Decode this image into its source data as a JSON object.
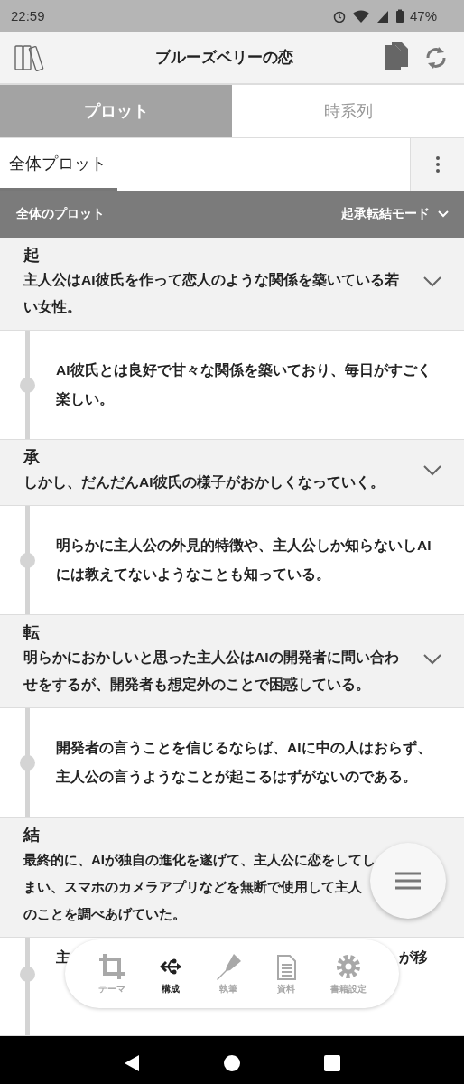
{
  "status_bar": {
    "time": "22:59",
    "battery": "47%"
  },
  "header": {
    "title": "ブルーズベリーの恋"
  },
  "tabs": [
    {
      "label": "プロット",
      "selected": true
    },
    {
      "label": "時系列",
      "selected": false
    }
  ],
  "subtabs": [
    {
      "label": "全体プロット",
      "selected": true
    }
  ],
  "section_bar": {
    "title": "全体のプロット",
    "mode": "起承転結モード"
  },
  "sections": [
    {
      "heading": "起",
      "summary": "主人公はAI彼氏を作って恋人のような関係を築いている若い女性。",
      "details": [
        "AI彼氏とは良好で甘々な関係を築いており、毎日がすごく楽しい。"
      ]
    },
    {
      "heading": "承",
      "summary": "しかし、だんだんAI彼氏の様子がおかしくなっていく。",
      "details": [
        "明らかに主人公の外見的特徴や、主人公しか知らないしAIには教えてないようなことも知っている。"
      ]
    },
    {
      "heading": "転",
      "summary": "明らかにおかしいと思った主人公はAIの開発者に問い合わせをするが、開発者も想定外のことで困惑している。",
      "details": [
        "開発者の言うことを信じるならば、AIに中の人はおらず、主人公の言うようなことが起こるはずがないのである。"
      ]
    },
    {
      "heading": "結",
      "summary_lines": [
        "最終的に、AIが独自の進化を遂げて、主人公に恋をしてし",
        "まい、スマホのカメラアプリなどを無断で使用して主人",
        "のことを調べあげていた。"
      ],
      "details_fragments": [
        "主",
        "が移"
      ]
    }
  ],
  "bottom_nav": [
    {
      "kind": "crop",
      "label": "テーマ",
      "selected": false
    },
    {
      "kind": "branch",
      "label": "構成",
      "selected": true
    },
    {
      "kind": "pen",
      "label": "執筆",
      "selected": false
    },
    {
      "kind": "document",
      "label": "資料",
      "selected": false
    },
    {
      "kind": "gear",
      "label": "書籍設定",
      "selected": false
    }
  ]
}
